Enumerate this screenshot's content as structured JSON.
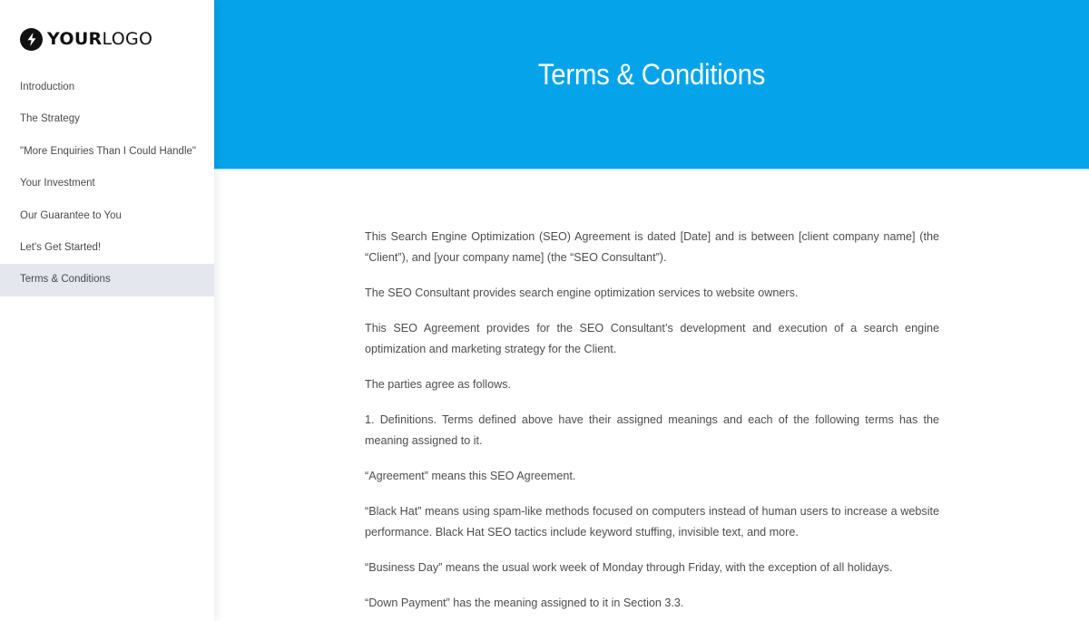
{
  "logo": {
    "icon": "lightning-bolt-icon",
    "text_bold": "YOUR",
    "text_light": "LOGO"
  },
  "sidebar": {
    "items": [
      {
        "label": "Introduction",
        "active": false
      },
      {
        "label": "The Strategy",
        "active": false
      },
      {
        "label": "\"More Enquiries Than I Could Handle\"",
        "active": false
      },
      {
        "label": "Your Investment",
        "active": false
      },
      {
        "label": "Our Guarantee to You",
        "active": false
      },
      {
        "label": "Let's Get Started!",
        "active": false
      },
      {
        "label": "Terms & Conditions",
        "active": true
      }
    ]
  },
  "header": {
    "title": "Terms & Conditions",
    "background_color": "#05a4ea"
  },
  "content": {
    "paragraphs": [
      "This Search Engine Optimization (SEO) Agreement is dated [Date] and is between [client company name] (the “Client”), and [your company name] (the “SEO Consultant”).",
      "The SEO Consultant provides search engine optimization services to website owners.",
      "This SEO Agreement provides for the SEO Consultant’s development and execution of a search engine optimization and marketing strategy for the Client.",
      "The parties agree as follows.",
      "1. Definitions. Terms defined above have their assigned meanings and each of the following terms has the meaning assigned to it.",
      "“Agreement” means this SEO Agreement.",
      "“Black Hat” means using spam-like methods focused on computers instead of human users to increase a website performance. Black Hat SEO tactics include keyword stuffing, invisible text, and more.",
      "“Business Day” means the usual work week of Monday through Friday, with the exception of all holidays.",
      "“Down Payment” has the meaning assigned to it in Section 3.3."
    ]
  }
}
